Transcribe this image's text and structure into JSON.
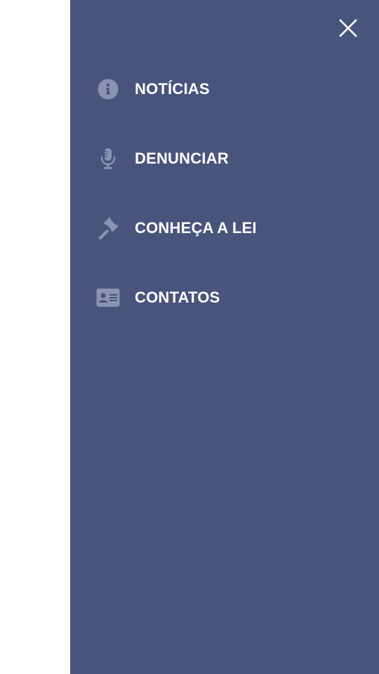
{
  "colors": {
    "drawer_background": "#49547c",
    "backdrop": "#ffffff",
    "icon": "#8a93b3",
    "label": "#ffffff"
  },
  "close_button": {
    "icon": "close-icon"
  },
  "menu": {
    "items": [
      {
        "label": "NOTÍCIAS",
        "icon": "info-circle-icon"
      },
      {
        "label": "DENUNCIAR",
        "icon": "microphone-icon"
      },
      {
        "label": "CONHEÇA A LEI",
        "icon": "gavel-icon"
      },
      {
        "label": "CONTATOS",
        "icon": "contact-card-icon"
      }
    ]
  }
}
